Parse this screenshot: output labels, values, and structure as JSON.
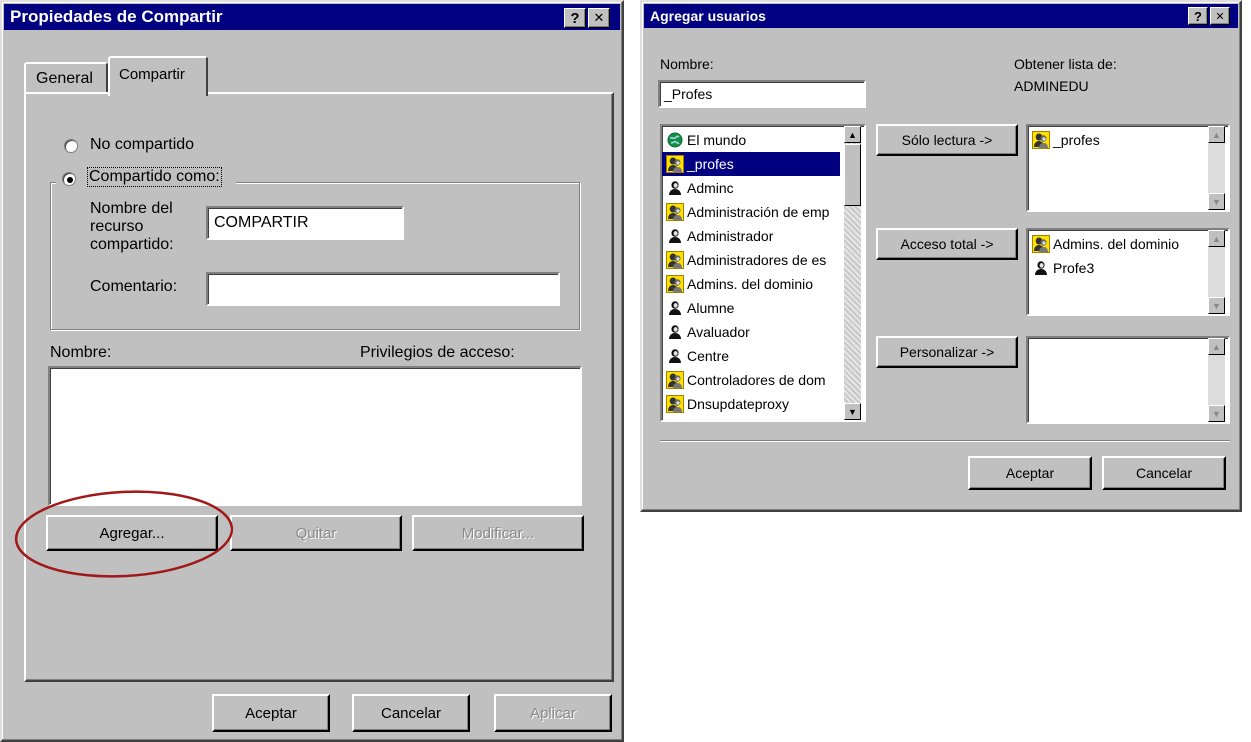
{
  "colors": {
    "titlebar": "#000080",
    "face": "#c0c0c0",
    "highlight_oval": "#a01818"
  },
  "share_dialog": {
    "title": "Propiedades de Compartir",
    "help_label": "?",
    "close_label": "✕",
    "tabs": [
      {
        "label": "General"
      },
      {
        "label": "Compartir"
      }
    ],
    "radio_not_shared": "No compartido",
    "radio_shared_as": "Compartido como:",
    "share_name_label": [
      "Nombre del",
      "recurso",
      "compartido:"
    ],
    "share_name_value": "COMPARTIR",
    "comment_label": "Comentario:",
    "comment_value": "",
    "list_name_header": "Nombre:",
    "list_access_header": "Privilegios de acceso:",
    "add_button": "Agregar...",
    "remove_button": "Quitar",
    "modify_button": "Modificar...",
    "ok_button": "Aceptar",
    "cancel_button": "Cancelar",
    "apply_button": "Aplicar"
  },
  "add_users_dialog": {
    "title": "Agregar usuarios",
    "help_label": "?",
    "close_label": "✕",
    "name_label": "Nombre:",
    "name_value": "_Profes",
    "get_list_label": "Obtener lista de:",
    "get_list_value": "ADMINEDU",
    "users": [
      {
        "label": "El mundo",
        "icon": "globe-icon"
      },
      {
        "label": "_profes",
        "icon": "group-icon",
        "selected": true
      },
      {
        "label": "Adminc",
        "icon": "user-icon"
      },
      {
        "label": "Administración de emp",
        "icon": "group-icon"
      },
      {
        "label": "Administrador",
        "icon": "user-icon"
      },
      {
        "label": "Administradores de es",
        "icon": "group-icon"
      },
      {
        "label": "Admins. del dominio",
        "icon": "group-icon"
      },
      {
        "label": "Alumne",
        "icon": "user-icon"
      },
      {
        "label": "Avaluador",
        "icon": "user-icon"
      },
      {
        "label": "Centre",
        "icon": "user-icon"
      },
      {
        "label": "Controladores de dom",
        "icon": "group-icon"
      },
      {
        "label": "Dnsupdateproxy",
        "icon": "group-icon"
      }
    ],
    "readonly_button": "Sólo lectura ->",
    "fullaccess_button": "Acceso total ->",
    "custom_button": "Personalizar ->",
    "readonly_list": [
      {
        "label": "_profes",
        "icon": "group-icon"
      }
    ],
    "fullaccess_list": [
      {
        "label": "Admins. del dominio",
        "icon": "group-icon"
      },
      {
        "label": "Profe3",
        "icon": "user-icon"
      }
    ],
    "custom_list": [],
    "ok_button": "Aceptar",
    "cancel_button": "Cancelar"
  }
}
